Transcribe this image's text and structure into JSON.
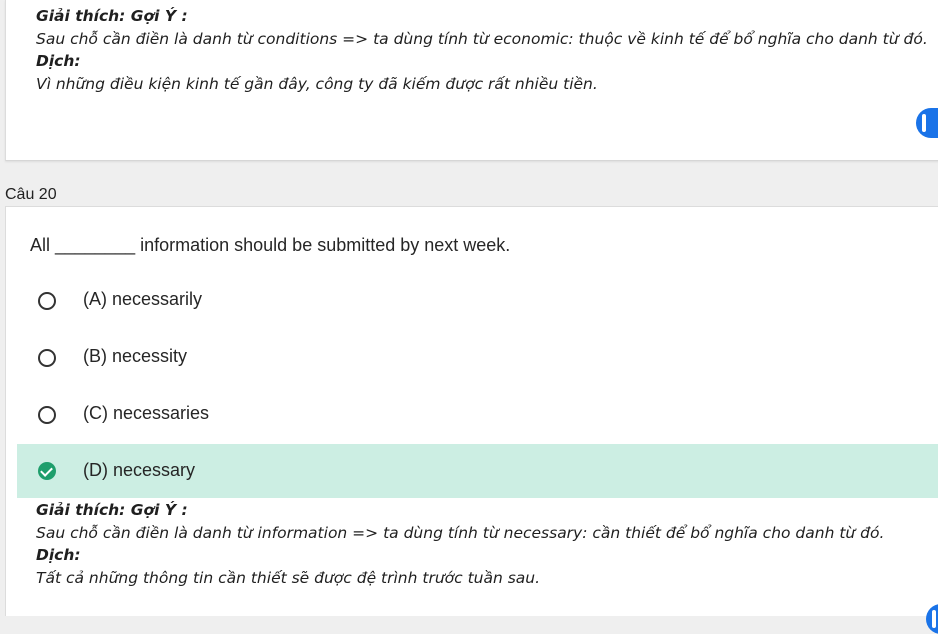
{
  "previous": {
    "explanation_heading": "Giải thích: Gợi Ý :",
    "explanation_text": "Sau chỗ cần điền là danh từ conditions => ta dùng tính từ economic: thuộc về kinh tế để bổ nghĩa cho danh từ đó.",
    "translation_heading": "Dịch:",
    "translation_text": "Vì những điều kiện kinh tế gần đây, công ty đã kiếm được rất nhiều tiền."
  },
  "question": {
    "label": "Câu 20",
    "prompt": "All ________ information should be submitted by next week.",
    "options": [
      {
        "label": "(A) necessarily",
        "selected": false
      },
      {
        "label": "(B) necessity",
        "selected": false
      },
      {
        "label": "(C) necessaries",
        "selected": false
      },
      {
        "label": "(D) necessary",
        "selected": true
      }
    ],
    "explanation_heading": "Giải thích: Gợi Ý :",
    "explanation_text": "Sau chỗ cần điền là danh từ information => ta dùng tính từ necessary: cần thiết để bổ nghĩa cho danh từ đó.",
    "translation_heading": "Dịch:",
    "translation_text": "Tất cả những thông tin cần thiết sẽ được đệ trình trước tuần sau."
  },
  "colors": {
    "selected_background": "#cceee3",
    "check_color": "#1e9e6c",
    "accent": "#1a73e8"
  }
}
